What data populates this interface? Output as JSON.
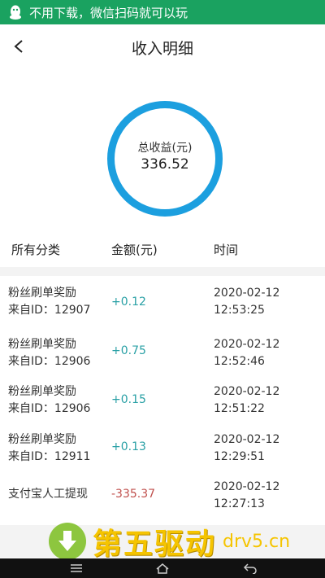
{
  "banner": {
    "text": "不用下载，微信扫码就可以玩",
    "icon": "qq-penguin-icon",
    "bg": "#1aa260"
  },
  "header": {
    "title": "收入明细",
    "back_icon": "chevron-left-icon"
  },
  "summary": {
    "label": "总收益(元)",
    "value": "336.52",
    "ring_color": "#1c9fdf"
  },
  "table": {
    "columns": [
      "所有分类",
      "金额(元)",
      "时间"
    ],
    "rows": [
      {
        "category": "粉丝刷单奖励",
        "source": "来自ID：12907",
        "amount": "+0.12",
        "date": "2020-02-12",
        "time": "12:53:25",
        "type": "pos"
      },
      {
        "category": "粉丝刷单奖励",
        "source": "来自ID：12906",
        "amount": "+0.75",
        "date": "2020-02-12",
        "time": "12:52:46",
        "type": "pos"
      },
      {
        "category": "粉丝刷单奖励",
        "source": "来自ID：12906",
        "amount": "+0.15",
        "date": "2020-02-12",
        "time": "12:51:22",
        "type": "pos"
      },
      {
        "category": "粉丝刷单奖励",
        "source": "来自ID：12911",
        "amount": "+0.13",
        "date": "2020-02-12",
        "time": "12:29:51",
        "type": "pos"
      },
      {
        "category": "支付宝人工提现",
        "source": "",
        "amount": "-335.37",
        "date": "2020-02-12",
        "time": "12:27:13",
        "type": "neg"
      }
    ]
  },
  "colors": {
    "positive": "#29a0a5",
    "negative": "#c0504d",
    "watermark": "#f5c400"
  },
  "watermark": {
    "brand": "第五驱动",
    "domain": "drv5.cn",
    "icon": "download-arrow-icon"
  },
  "navbar": {
    "icons": [
      "menu-icon",
      "home-icon",
      "back-icon"
    ]
  }
}
